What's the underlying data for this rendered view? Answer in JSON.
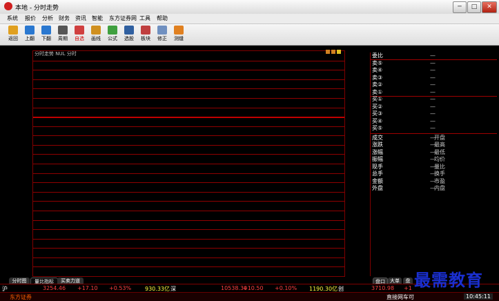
{
  "window": {
    "title": "本地 - 分时走势",
    "min": "─",
    "max": "□",
    "close": "✕"
  },
  "menu": [
    "系统",
    "报价",
    "分析",
    "财务",
    "资讯",
    "智能",
    "东方证券网",
    "工具",
    "帮助"
  ],
  "toolbar": [
    {
      "label": "返回",
      "icon": "back-arrow-icon",
      "color": "#e0a020"
    },
    {
      "label": "上翻",
      "icon": "up-arrow-icon",
      "color": "#2a78d0"
    },
    {
      "label": "下翻",
      "icon": "down-arrow-icon",
      "color": "#2a78d0"
    },
    {
      "label": "周期",
      "icon": "f8-key-icon",
      "color": "#555555"
    },
    {
      "label": "自选",
      "icon": "star-document-icon",
      "color": "#d04040",
      "red": true
    },
    {
      "label": "画线",
      "icon": "pencil-icon",
      "color": "#d09020"
    },
    {
      "label": "公式",
      "icon": "formula-icon",
      "color": "#40a040"
    },
    {
      "label": "选股",
      "icon": "screen-icon",
      "color": "#3060a0"
    },
    {
      "label": "板块",
      "icon": "sector-book-icon",
      "color": "#c04040"
    },
    {
      "label": "修正",
      "icon": "eraser-icon",
      "color": "#7090c0"
    },
    {
      "label": "测缝",
      "icon": "gear-icon",
      "color": "#e08020"
    }
  ],
  "chart": {
    "header": "分时走势  NUL  分时"
  },
  "quote": {
    "orders": [
      "委比",
      "卖⑤",
      "卖④",
      "卖③",
      "卖②",
      "卖①",
      "买①",
      "买②",
      "买③",
      "买④",
      "买⑤"
    ],
    "orders_value": "—",
    "stats_left": [
      "成交",
      "涨跌",
      "涨幅",
      "振幅",
      "现手",
      "总手",
      "金额",
      "外盘"
    ],
    "stats_right": [
      "开盘",
      "最高",
      "最低",
      "均价",
      "量比",
      "换手",
      "市盈",
      "内盘"
    ],
    "dash": "—"
  },
  "tabs_left": [
    "分时图",
    "量比指标",
    "买卖力道"
  ],
  "tabs_right": [
    "盘口",
    "大单",
    "盘"
  ],
  "status": {
    "sh_label": "沪",
    "sh_index": "3254.46",
    "sh_change": "+17.10",
    "sh_pct": "+0.53%",
    "sh_amount": "930.33亿",
    "sz_label": "深",
    "sz_index": "10538.30",
    "sz_change": "+10.50",
    "sz_pct": "+0.10%",
    "sz_amount": "1190.30亿",
    "cy_label": "创",
    "cy_index": "3710.98",
    "cy_change": "+1"
  },
  "bottom": {
    "brand": "东方证券",
    "link": "直接网车可",
    "time": "10:45:11"
  },
  "watermark": "最需教育"
}
